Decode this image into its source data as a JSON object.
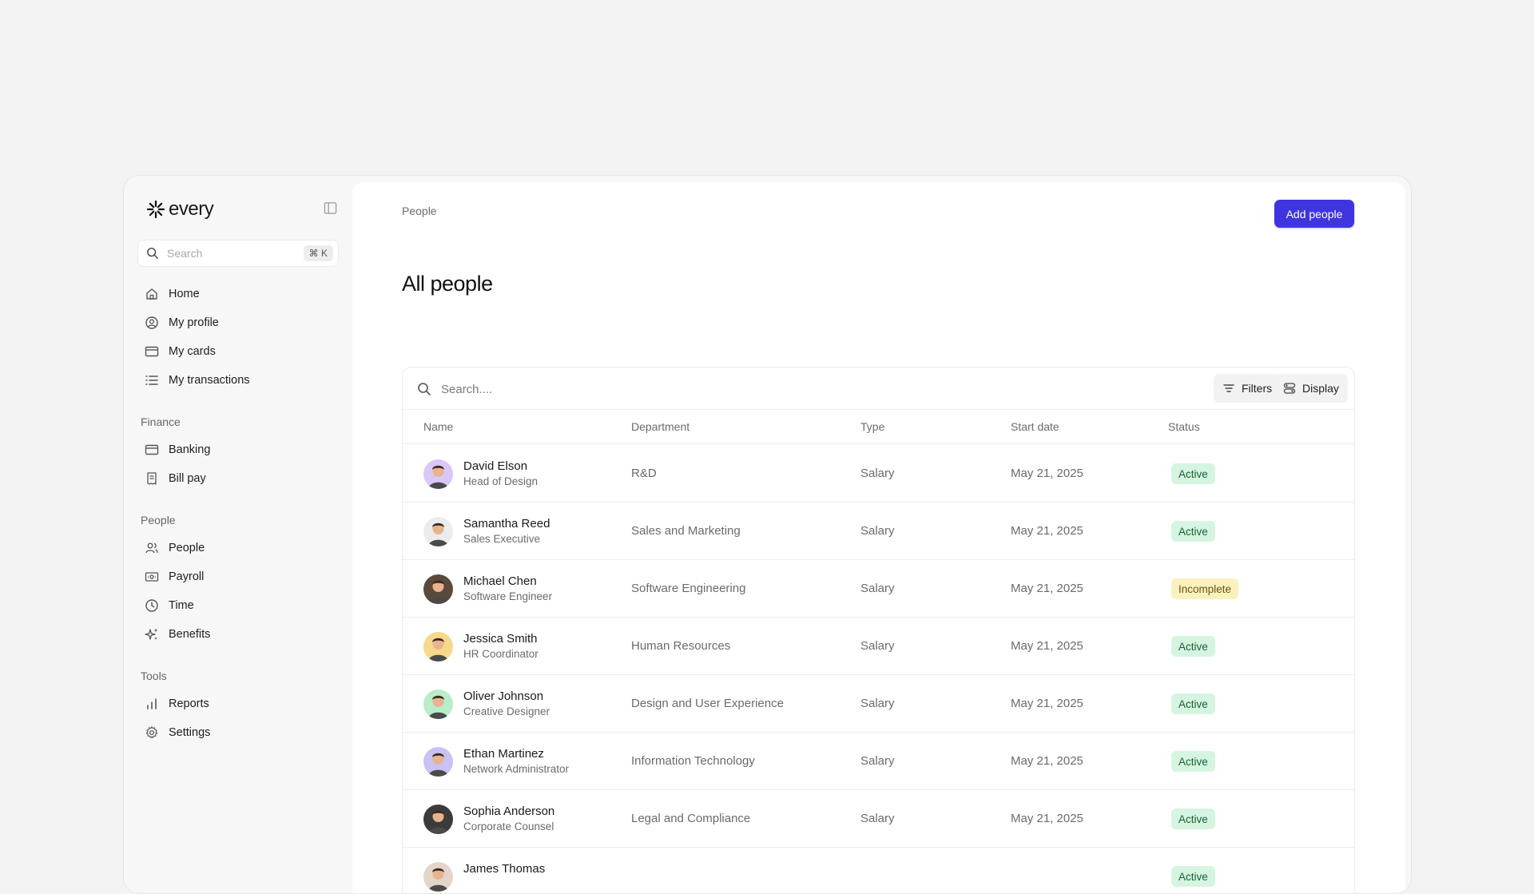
{
  "sidebar": {
    "brand": "every",
    "search": {
      "placeholder": "Search",
      "shortcut": "⌘ K"
    },
    "items": [
      {
        "label": "Home",
        "icon": "home-icon"
      },
      {
        "label": "My profile",
        "icon": "user-circle-icon"
      },
      {
        "label": "My cards",
        "icon": "card-icon"
      },
      {
        "label": "My transactions",
        "icon": "list-icon"
      }
    ],
    "groups": [
      {
        "title": "Finance",
        "items": [
          {
            "label": "Banking",
            "icon": "bank-card-icon"
          },
          {
            "label": "Bill pay",
            "icon": "receipt-icon"
          }
        ]
      },
      {
        "title": "People",
        "items": [
          {
            "label": "People",
            "icon": "people-icon"
          },
          {
            "label": "Payroll",
            "icon": "payroll-icon"
          },
          {
            "label": "Time",
            "icon": "clock-icon"
          },
          {
            "label": "Benefits",
            "icon": "sparkle-icon"
          }
        ]
      },
      {
        "title": "Tools",
        "items": [
          {
            "label": "Reports",
            "icon": "bar-chart-icon"
          },
          {
            "label": "Settings",
            "icon": "gear-icon"
          }
        ]
      }
    ]
  },
  "main": {
    "breadcrumb": "People",
    "add_button": "Add people",
    "title": "All people",
    "table": {
      "search_placeholder": "Search....",
      "filters_label": "Filters",
      "display_label": "Display",
      "columns": [
        "Name",
        "Department",
        "Type",
        "Start date",
        "Status"
      ],
      "rows": [
        {
          "name": "David Elson",
          "role": "Head of Design",
          "department": "R&D",
          "type": "Salary",
          "start": "May 21, 2025",
          "status": "Active"
        },
        {
          "name": "Samantha Reed",
          "role": "Sales Executive",
          "department": "Sales and Marketing",
          "type": "Salary",
          "start": "May 21, 2025",
          "status": "Active"
        },
        {
          "name": "Michael Chen",
          "role": "Software Engineer",
          "department": "Software Engineering",
          "type": "Salary",
          "start": "May 21, 2025",
          "status": "Incomplete"
        },
        {
          "name": "Jessica Smith",
          "role": "HR Coordinator",
          "department": "Human Resources",
          "type": "Salary",
          "start": "May 21, 2025",
          "status": "Active"
        },
        {
          "name": "Oliver Johnson",
          "role": "Creative Designer",
          "department": "Design and User Experience",
          "type": "Salary",
          "start": "May 21, 2025",
          "status": "Active"
        },
        {
          "name": "Ethan Martinez",
          "role": "Network Administrator",
          "department": "Information Technology",
          "type": "Salary",
          "start": "May 21, 2025",
          "status": "Active"
        },
        {
          "name": "Sophia Anderson",
          "role": "Corporate Counsel",
          "department": "Legal and Compliance",
          "type": "Salary",
          "start": "May 21, 2025",
          "status": "Active"
        },
        {
          "name": "James Thomas",
          "role": "",
          "department": "",
          "type": "",
          "start": "",
          "status": "Active"
        }
      ]
    }
  },
  "colors": {
    "accent": "#3f35e0",
    "active_bg": "#d5f5e1",
    "active_text": "#17603a",
    "incomplete_bg": "#faf1bf",
    "incomplete_text": "#6b5510",
    "avatar_bgs": [
      "#d9c8f7",
      "#ececec",
      "#5a4a3c",
      "#f7d98a",
      "#b9ecc9",
      "#c9c2f5",
      "#3b3b3b",
      "#e3d6c8"
    ]
  }
}
